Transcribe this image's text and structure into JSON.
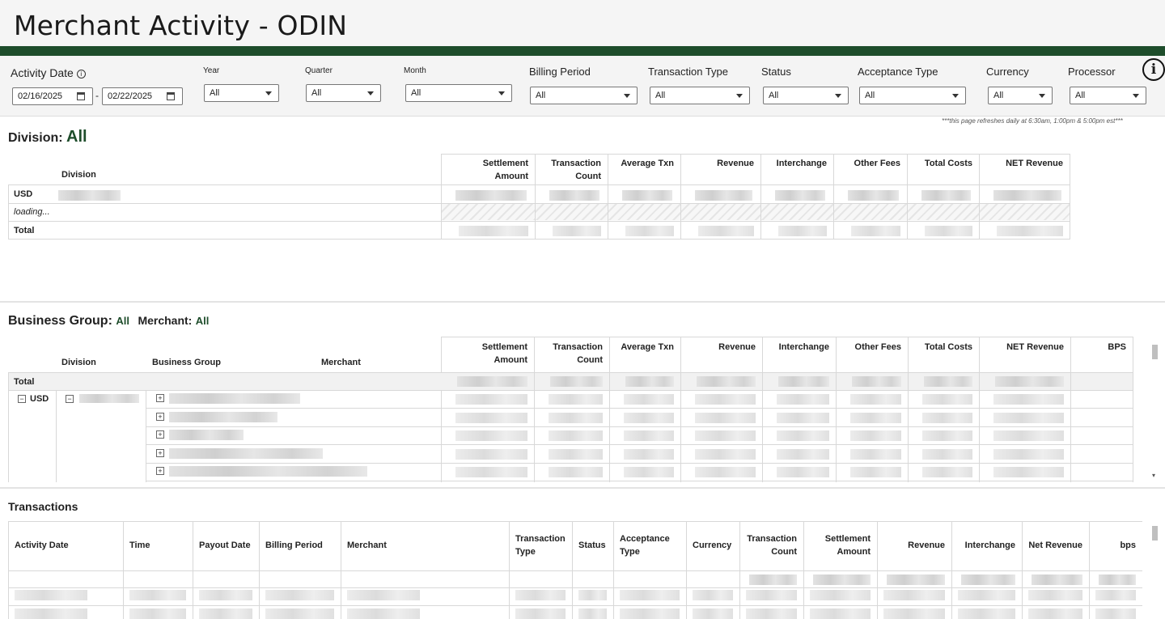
{
  "page": {
    "title": "Merchant Activity - ODIN",
    "refresh_note": "***this page refreshes daily at 6:30am, 1:00pm & 5:00pm est***"
  },
  "colors": {
    "brand_green": "#1e4d2b"
  },
  "filters": {
    "activity_date": {
      "label": "Activity Date",
      "start": "02/16/2025",
      "separator": "-",
      "end": "02/22/2025"
    },
    "year": {
      "label": "Year",
      "value": "All"
    },
    "quarter": {
      "label": "Quarter",
      "value": "All"
    },
    "month": {
      "label": "Month",
      "value": "All"
    },
    "billing_period": {
      "label": "Billing Period",
      "value": "All"
    },
    "transaction_type": {
      "label": "Transaction Type",
      "value": "All"
    },
    "status": {
      "label": "Status",
      "value": "All"
    },
    "acceptance_type": {
      "label": "Acceptance Type",
      "value": "All"
    },
    "currency": {
      "label": "Currency",
      "value": "All"
    },
    "processor": {
      "label": "Processor",
      "value": "All"
    },
    "info_icon": "i"
  },
  "division_section": {
    "title": "Division:",
    "value": "All",
    "row_header": "Division",
    "columns": [
      "Settlement\nAmount",
      "Transaction\nCount",
      "Average Txn",
      "Revenue",
      "Interchange",
      "Other Fees",
      "Total Costs",
      "NET Revenue"
    ],
    "rows": [
      {
        "label": "USD"
      },
      {
        "label": "loading..."
      },
      {
        "label": "Total"
      }
    ]
  },
  "business_section": {
    "title": "Business Group:",
    "bg_value": "All",
    "merchant_label": "Merchant:",
    "merchant_value": "All",
    "headers": {
      "division": "Division",
      "business_group": "Business Group",
      "merchant": "Merchant"
    },
    "columns": [
      "Settlement\nAmount",
      "Transaction\nCount",
      "Average Txn",
      "Revenue",
      "Interchange",
      "Other Fees",
      "Total Costs",
      "NET Revenue",
      "BPS"
    ],
    "total_label": "Total",
    "currency_label": "USD"
  },
  "transactions_section": {
    "title": "Transactions",
    "columns": [
      "Activity Date",
      "Time",
      "Payout Date",
      "Billing Period",
      "Merchant",
      "Transaction\nType",
      "Status",
      "Acceptance\nType",
      "Currency",
      "Transaction\nCount",
      "Settlement\nAmount",
      "Revenue",
      "Interchange",
      "Net  Revenue",
      "bps"
    ]
  }
}
